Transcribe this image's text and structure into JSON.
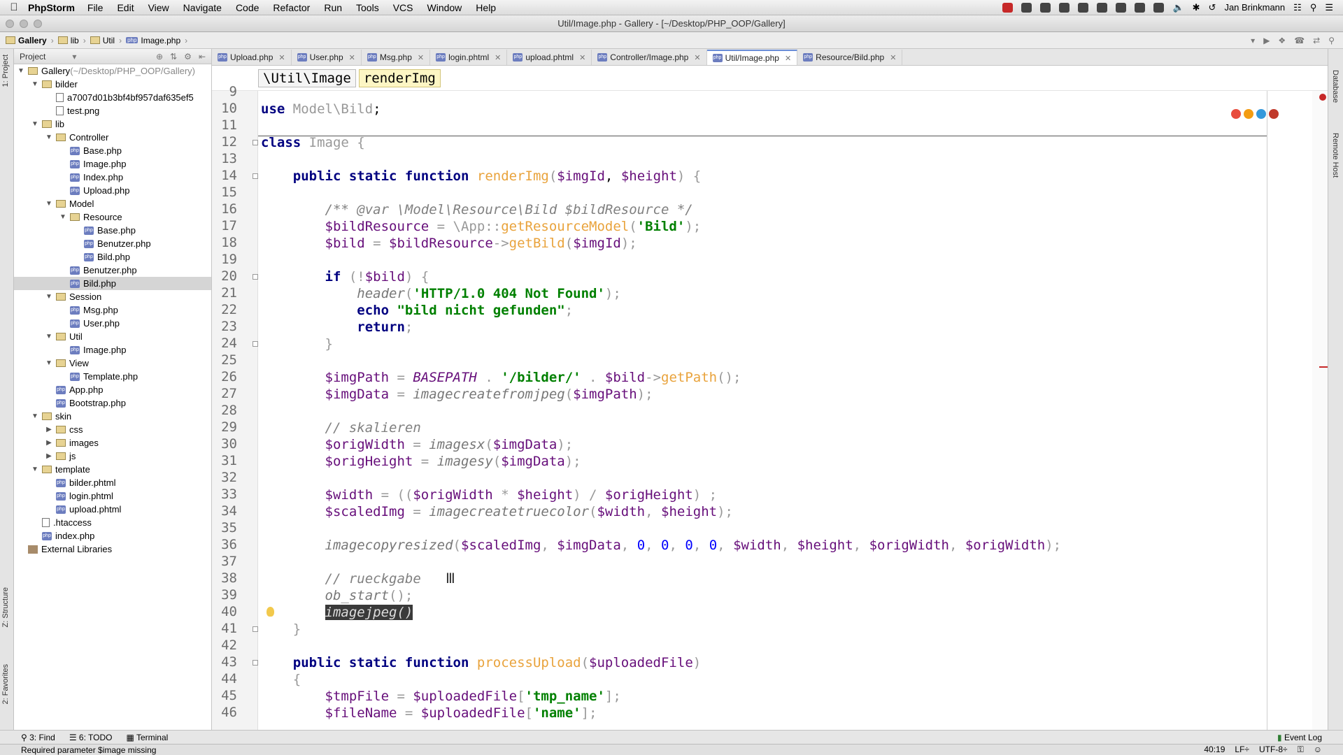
{
  "menubar": {
    "app": "PhpStorm",
    "items": [
      "File",
      "Edit",
      "View",
      "Navigate",
      "Code",
      "Refactor",
      "Run",
      "Tools",
      "VCS",
      "Window",
      "Help"
    ],
    "user": "Jan Brinkmann"
  },
  "window": {
    "title": "Util/Image.php - Gallery - [~/Desktop/PHP_OOP/Gallery]"
  },
  "breadcrumb": [
    "Gallery",
    "lib",
    "Util",
    "Image.php"
  ],
  "project_panel": {
    "title": "Project",
    "tree": [
      {
        "label": "Gallery",
        "suffix": " (~/Desktop/PHP_OOP/Gallery)",
        "depth": 0,
        "type": "folder",
        "open": true
      },
      {
        "label": "bilder",
        "depth": 1,
        "type": "folder",
        "open": true
      },
      {
        "label": "a7007d01b3bf4bf957daf635ef5",
        "depth": 2,
        "type": "generic"
      },
      {
        "label": "test.png",
        "depth": 2,
        "type": "generic"
      },
      {
        "label": "lib",
        "depth": 1,
        "type": "folder",
        "open": true
      },
      {
        "label": "Controller",
        "depth": 2,
        "type": "folder",
        "open": true
      },
      {
        "label": "Base.php",
        "depth": 3,
        "type": "php"
      },
      {
        "label": "Image.php",
        "depth": 3,
        "type": "php"
      },
      {
        "label": "Index.php",
        "depth": 3,
        "type": "php"
      },
      {
        "label": "Upload.php",
        "depth": 3,
        "type": "php"
      },
      {
        "label": "Model",
        "depth": 2,
        "type": "folder",
        "open": true
      },
      {
        "label": "Resource",
        "depth": 3,
        "type": "folder",
        "open": true
      },
      {
        "label": "Base.php",
        "depth": 4,
        "type": "php"
      },
      {
        "label": "Benutzer.php",
        "depth": 4,
        "type": "php"
      },
      {
        "label": "Bild.php",
        "depth": 4,
        "type": "php"
      },
      {
        "label": "Benutzer.php",
        "depth": 3,
        "type": "php"
      },
      {
        "label": "Bild.php",
        "depth": 3,
        "type": "php",
        "selected": true
      },
      {
        "label": "Session",
        "depth": 2,
        "type": "folder",
        "open": true
      },
      {
        "label": "Msg.php",
        "depth": 3,
        "type": "php"
      },
      {
        "label": "User.php",
        "depth": 3,
        "type": "php"
      },
      {
        "label": "Util",
        "depth": 2,
        "type": "folder",
        "open": true
      },
      {
        "label": "Image.php",
        "depth": 3,
        "type": "php"
      },
      {
        "label": "View",
        "depth": 2,
        "type": "folder",
        "open": true
      },
      {
        "label": "Template.php",
        "depth": 3,
        "type": "php"
      },
      {
        "label": "App.php",
        "depth": 2,
        "type": "php"
      },
      {
        "label": "Bootstrap.php",
        "depth": 2,
        "type": "php"
      },
      {
        "label": "skin",
        "depth": 1,
        "type": "folder",
        "open": true
      },
      {
        "label": "css",
        "depth": 2,
        "type": "folder",
        "open": false
      },
      {
        "label": "images",
        "depth": 2,
        "type": "folder",
        "open": false
      },
      {
        "label": "js",
        "depth": 2,
        "type": "folder",
        "open": false
      },
      {
        "label": "template",
        "depth": 1,
        "type": "folder",
        "open": true
      },
      {
        "label": "bilder.phtml",
        "depth": 2,
        "type": "php"
      },
      {
        "label": "login.phtml",
        "depth": 2,
        "type": "php"
      },
      {
        "label": "upload.phtml",
        "depth": 2,
        "type": "php"
      },
      {
        "label": ".htaccess",
        "depth": 1,
        "type": "generic"
      },
      {
        "label": "index.php",
        "depth": 1,
        "type": "php"
      },
      {
        "label": "External Libraries",
        "depth": 0,
        "type": "lib"
      }
    ]
  },
  "tabs": [
    {
      "label": "Upload.php",
      "active": false
    },
    {
      "label": "User.php",
      "active": false
    },
    {
      "label": "Msg.php",
      "active": false
    },
    {
      "label": "login.phtml",
      "active": false
    },
    {
      "label": "upload.phtml",
      "active": false
    },
    {
      "label": "Controller/Image.php",
      "active": false
    },
    {
      "label": "Util/Image.php",
      "active": true
    },
    {
      "label": "Resource/Bild.php",
      "active": false
    }
  ],
  "editor_crumbs": [
    "\\Util\\Image",
    "renderImg"
  ],
  "code": {
    "first_line": 9,
    "lines": [
      [],
      [
        [
          "kw",
          "use "
        ],
        [
          "cls",
          "Model\\Bild"
        ],
        [
          "",
          "; "
        ]
      ],
      [],
      [
        [
          "kw",
          "class "
        ],
        [
          "cls",
          "Image "
        ],
        [
          "cls",
          "{"
        ]
      ],
      [],
      [
        [
          "",
          "    "
        ],
        [
          "kw",
          "public static function "
        ],
        [
          "fn",
          "renderImg"
        ],
        [
          "cls",
          "("
        ],
        [
          "var",
          "$imgId"
        ],
        [
          "",
          ", "
        ],
        [
          "var",
          "$height"
        ],
        [
          "cls",
          ") {"
        ]
      ],
      [],
      [
        [
          "",
          "        "
        ],
        [
          "cmt",
          "/** "
        ],
        [
          "cmt",
          "@var "
        ],
        [
          "cmt",
          "\\Model\\Resource\\Bild $bildResource */"
        ]
      ],
      [
        [
          "",
          "        "
        ],
        [
          "var",
          "$bildResource"
        ],
        [
          "cls",
          " = \\App::"
        ],
        [
          "fn",
          "getResourceModel"
        ],
        [
          "cls",
          "("
        ],
        [
          "str",
          "'Bild'"
        ],
        [
          "cls",
          ");"
        ]
      ],
      [
        [
          "",
          "        "
        ],
        [
          "var",
          "$bild"
        ],
        [
          "cls",
          " = "
        ],
        [
          "var",
          "$bildResource"
        ],
        [
          "cls",
          "->"
        ],
        [
          "fn",
          "getBild"
        ],
        [
          "cls",
          "("
        ],
        [
          "var",
          "$imgId"
        ],
        [
          "cls",
          ");"
        ]
      ],
      [],
      [
        [
          "",
          "        "
        ],
        [
          "kw",
          "if "
        ],
        [
          "cls",
          "(!"
        ],
        [
          "var",
          "$bild"
        ],
        [
          "cls",
          ") {"
        ]
      ],
      [
        [
          "",
          "            "
        ],
        [
          "ital",
          "header"
        ],
        [
          "cls",
          "("
        ],
        [
          "str",
          "'HTTP/1.0 404 Not Found'"
        ],
        [
          "cls",
          ");"
        ]
      ],
      [
        [
          "",
          "            "
        ],
        [
          "kw",
          "echo "
        ],
        [
          "str",
          "\"bild nicht gefunden\""
        ],
        [
          "cls",
          ";"
        ]
      ],
      [
        [
          "",
          "            "
        ],
        [
          "kw",
          "return"
        ],
        [
          "cls",
          ";"
        ]
      ],
      [
        [
          "",
          "        "
        ],
        [
          "cls",
          "}"
        ]
      ],
      [],
      [
        [
          "",
          "        "
        ],
        [
          "var",
          "$imgPath"
        ],
        [
          "cls",
          " = "
        ],
        [
          "cst",
          "BASEPATH"
        ],
        [
          "cls",
          " . "
        ],
        [
          "str",
          "'/bilder/'"
        ],
        [
          "cls",
          " . "
        ],
        [
          "var",
          "$bild"
        ],
        [
          "cls",
          "->"
        ],
        [
          "fn",
          "getPath"
        ],
        [
          "cls",
          "();"
        ]
      ],
      [
        [
          "",
          "        "
        ],
        [
          "var",
          "$imgData"
        ],
        [
          "cls",
          " = "
        ],
        [
          "ital",
          "imagecreatefromjpeg"
        ],
        [
          "cls",
          "("
        ],
        [
          "var",
          "$imgPath"
        ],
        [
          "cls",
          ");"
        ]
      ],
      [],
      [
        [
          "",
          "        "
        ],
        [
          "cmt",
          "// skalieren"
        ]
      ],
      [
        [
          "",
          "        "
        ],
        [
          "var",
          "$origWidth"
        ],
        [
          "cls",
          " = "
        ],
        [
          "ital",
          "imagesx"
        ],
        [
          "cls",
          "("
        ],
        [
          "var",
          "$imgData"
        ],
        [
          "cls",
          ");"
        ]
      ],
      [
        [
          "",
          "        "
        ],
        [
          "var",
          "$origHeight"
        ],
        [
          "cls",
          " = "
        ],
        [
          "ital",
          "imagesy"
        ],
        [
          "cls",
          "("
        ],
        [
          "var",
          "$imgData"
        ],
        [
          "cls",
          ");"
        ]
      ],
      [],
      [
        [
          "",
          "        "
        ],
        [
          "var",
          "$width"
        ],
        [
          "cls",
          " = (("
        ],
        [
          "var",
          "$origWidth"
        ],
        [
          "cls",
          " * "
        ],
        [
          "var",
          "$height"
        ],
        [
          "cls",
          ") / "
        ],
        [
          "var",
          "$origHeight"
        ],
        [
          "cls",
          ") ;"
        ]
      ],
      [
        [
          "",
          "        "
        ],
        [
          "var",
          "$scaledImg"
        ],
        [
          "cls",
          " = "
        ],
        [
          "ital",
          "imagecreatetruecolor"
        ],
        [
          "cls",
          "("
        ],
        [
          "var",
          "$width"
        ],
        [
          "cls",
          ", "
        ],
        [
          "var",
          "$height"
        ],
        [
          "cls",
          ");"
        ]
      ],
      [],
      [
        [
          "",
          "        "
        ],
        [
          "ital",
          "imagecopyresized"
        ],
        [
          "cls",
          "("
        ],
        [
          "var",
          "$scaledImg"
        ],
        [
          "cls",
          ", "
        ],
        [
          "var",
          "$imgData"
        ],
        [
          "cls",
          ", "
        ],
        [
          "num",
          "0"
        ],
        [
          "cls",
          ", "
        ],
        [
          "num",
          "0"
        ],
        [
          "cls",
          ", "
        ],
        [
          "num",
          "0"
        ],
        [
          "cls",
          ", "
        ],
        [
          "num",
          "0"
        ],
        [
          "cls",
          ", "
        ],
        [
          "var",
          "$width"
        ],
        [
          "cls",
          ", "
        ],
        [
          "var",
          "$height"
        ],
        [
          "cls",
          ", "
        ],
        [
          "var",
          "$origWidth"
        ],
        [
          "cls",
          ", "
        ],
        [
          "var",
          "$origWidth"
        ],
        [
          "cls",
          ");"
        ]
      ],
      [],
      [
        [
          "",
          "        "
        ],
        [
          "cmt",
          "// rueckgabe"
        ]
      ],
      [
        [
          "",
          "        "
        ],
        [
          "ital",
          "ob_start"
        ],
        [
          "cls",
          "();"
        ]
      ],
      [
        [
          "",
          "        "
        ],
        [
          "sel",
          "imagejpeg()"
        ]
      ],
      [
        [
          "",
          "    "
        ],
        [
          "cls",
          "}"
        ]
      ],
      [],
      [
        [
          "",
          "    "
        ],
        [
          "kw",
          "public static function "
        ],
        [
          "fn",
          "processUpload"
        ],
        [
          "cls",
          "("
        ],
        [
          "var",
          "$uploadedFile"
        ],
        [
          "cls",
          ")"
        ]
      ],
      [
        [
          "",
          "    "
        ],
        [
          "cls",
          "{"
        ]
      ],
      [
        [
          "",
          "        "
        ],
        [
          "var",
          "$tmpFile"
        ],
        [
          "cls",
          " = "
        ],
        [
          "var",
          "$uploadedFile"
        ],
        [
          "cls",
          "["
        ],
        [
          "str",
          "'tmp_name'"
        ],
        [
          "cls",
          "];"
        ]
      ],
      [
        [
          "",
          "        "
        ],
        [
          "var",
          "$fileName"
        ],
        [
          "cls",
          " = "
        ],
        [
          "var",
          "$uploadedFile"
        ],
        [
          "cls",
          "["
        ],
        [
          "str",
          "'name'"
        ],
        [
          "cls",
          "];"
        ]
      ]
    ]
  },
  "bottom_tools": {
    "find": "3: Find",
    "todo": "6: TODO",
    "terminal": "Terminal",
    "event_log": "Event Log"
  },
  "status": {
    "message": "Required parameter $image missing",
    "position": "40:19",
    "line_sep": "LF÷",
    "encoding": "UTF-8÷"
  },
  "side_labels": {
    "project": "1: Project",
    "structure": "Z: Structure",
    "favorites": "2: Favorites",
    "database": "Database",
    "remote": "Remote Host"
  }
}
